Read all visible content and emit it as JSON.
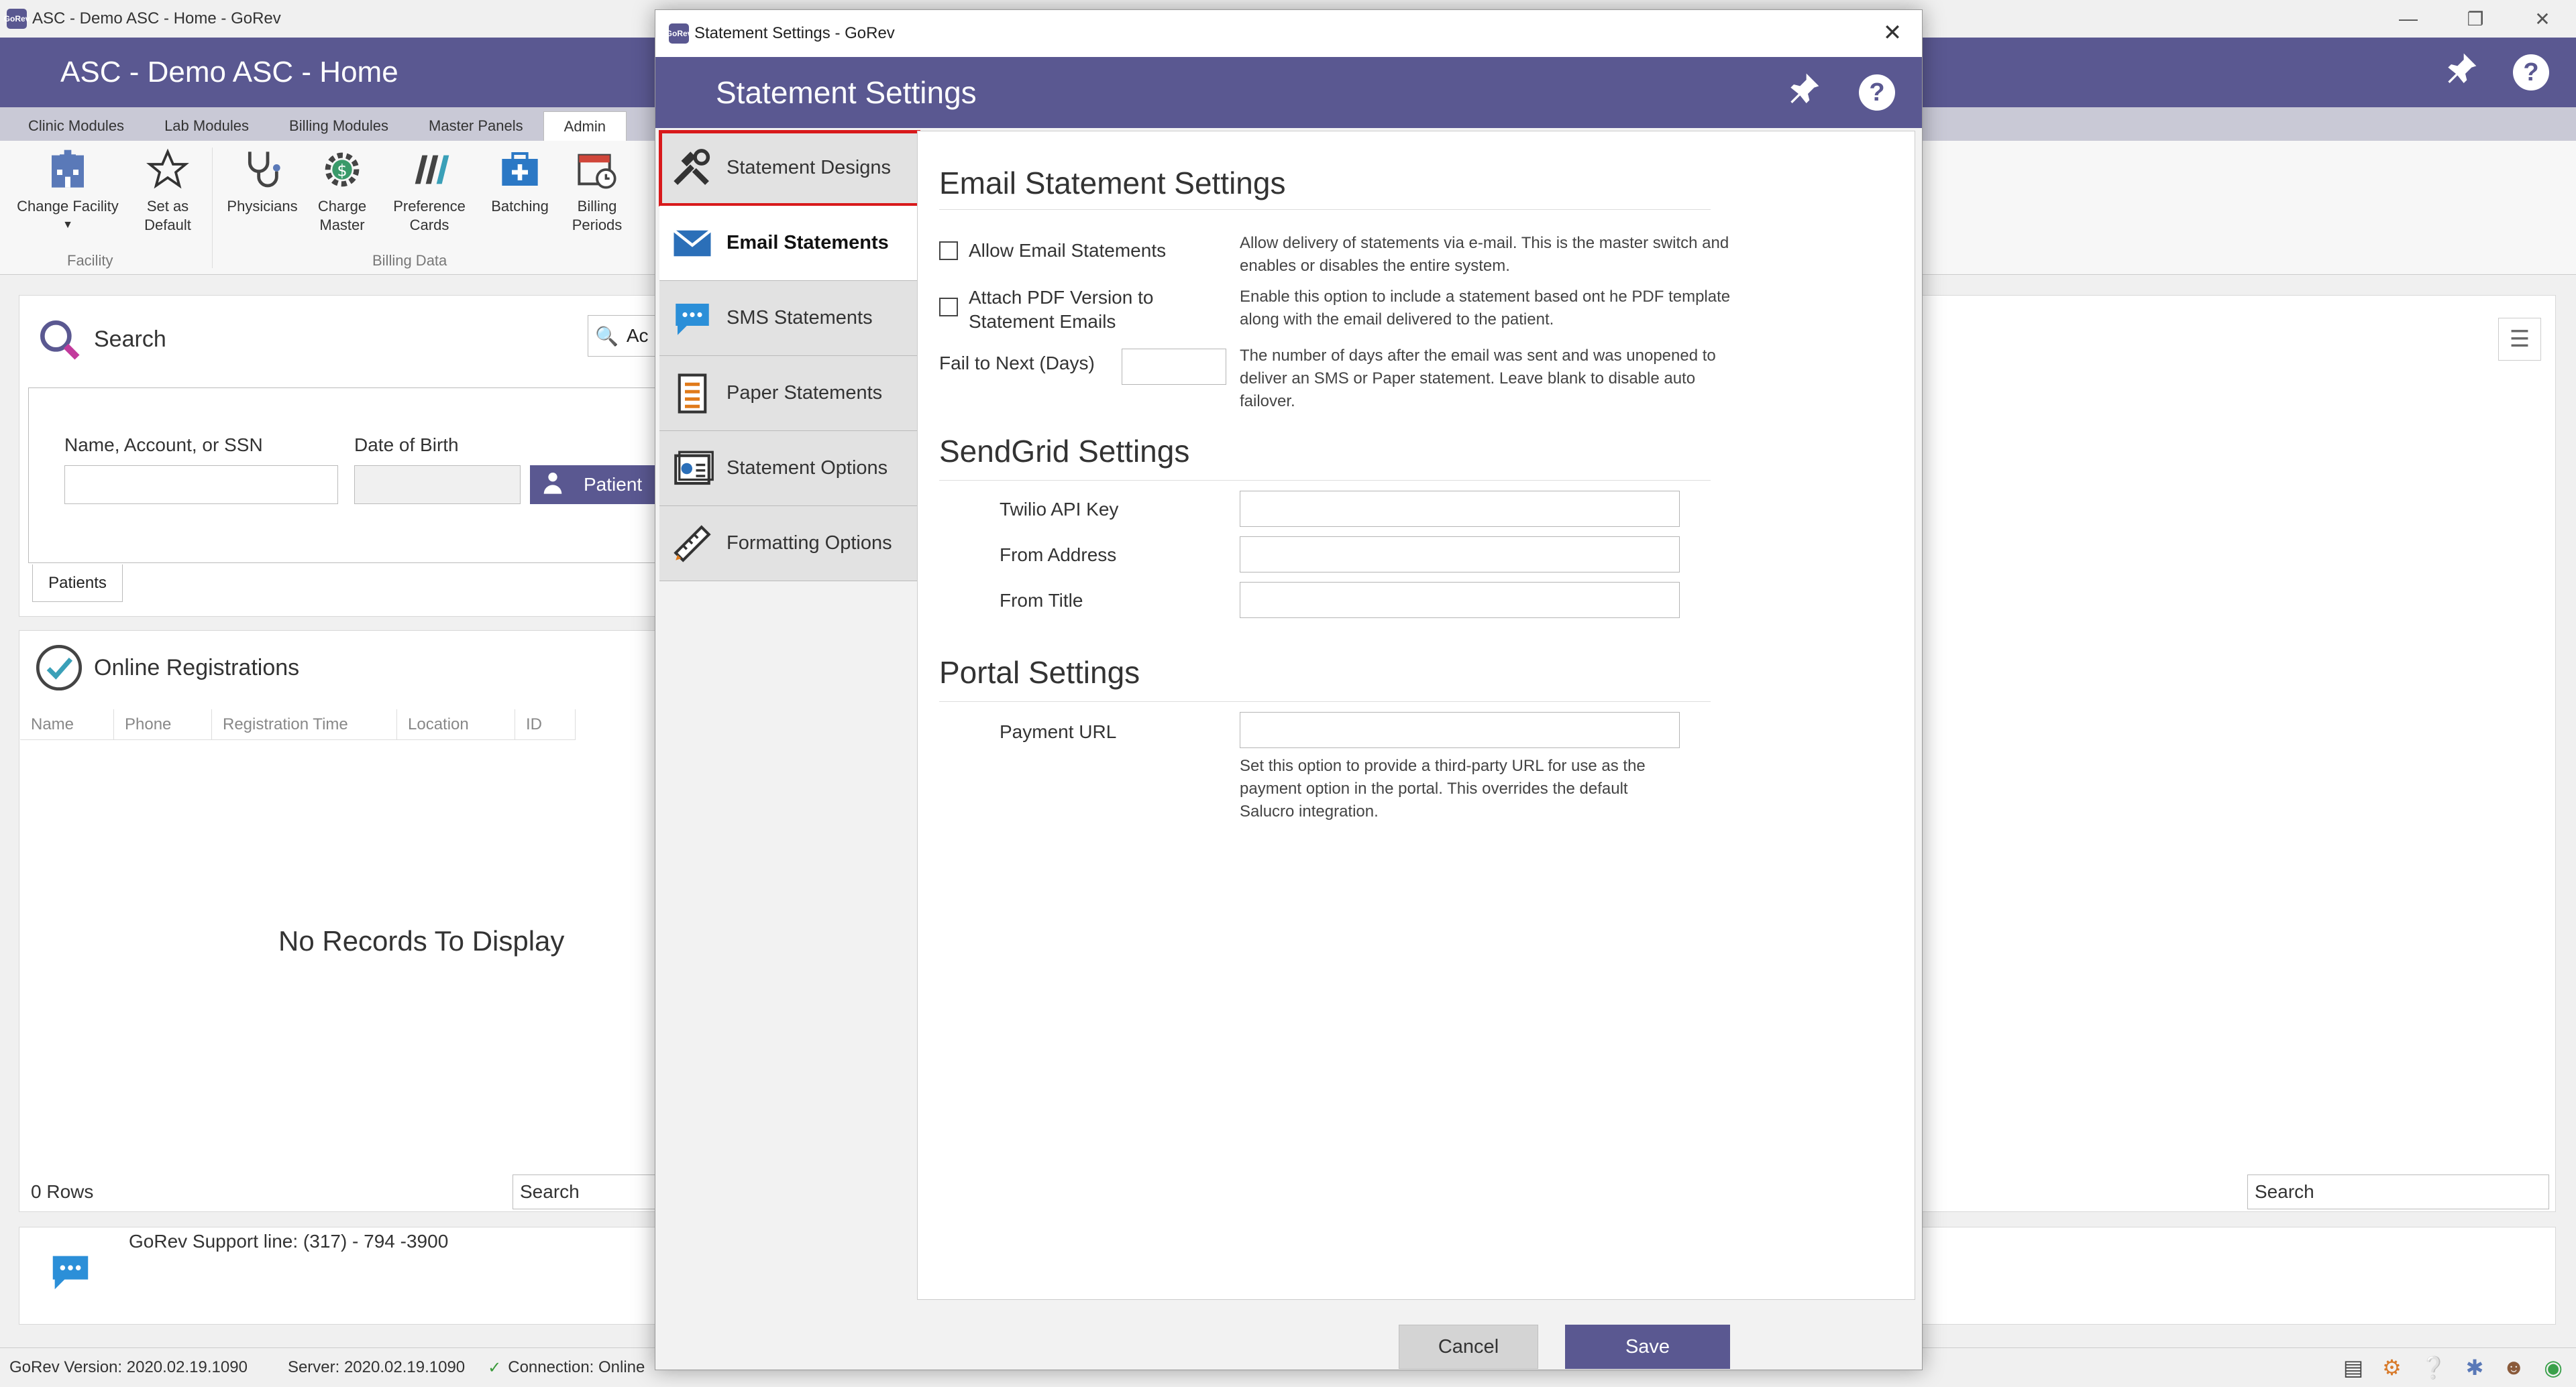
{
  "main_window": {
    "titlebar_text": "ASC - Demo ASC - Home - GoRev",
    "app_logo_text": "GoRev",
    "header_title": "ASC - Demo ASC - Home",
    "ribbon_tabs": [
      "Clinic Modules",
      "Lab Modules",
      "Billing Modules",
      "Master Panels",
      "Admin"
    ],
    "ribbon_buttons": {
      "change_facility": "Change Facility",
      "set_as_default": "Set as Default",
      "physicians": "Physicians",
      "charge_master": "Charge Master",
      "preference_cards": "Preference Cards",
      "batching": "Batching",
      "billing_periods": "Billing Periods"
    },
    "ribbon_groups": {
      "facility": "Facility",
      "billing_data": "Billing Data"
    },
    "search_panel": {
      "title": "Search",
      "name_label": "Name, Account, or SSN",
      "dob_label": "Date of Birth",
      "patient_button": "Patient",
      "patients_tab": "Patients",
      "quick_search_fragment": "Ac"
    },
    "online_registrations": {
      "title": "Online Registrations",
      "columns": [
        "Name",
        "Phone",
        "Registration Time",
        "Location",
        "ID"
      ],
      "empty_text": "No Records To Display",
      "row_count": "0 Rows",
      "search_placeholder": "Search",
      "right_search_placeholder": "Search"
    },
    "support_line": "GoRev Support line: (317) - 794 -3900",
    "status": {
      "version": "GoRev Version: 2020.02.19.1090",
      "server": "Server: 2020.02.19.1090",
      "connection": "Connection: Online"
    }
  },
  "dialog": {
    "window_title": "Statement Settings - GoRev",
    "header_title": "Statement Settings",
    "nav": [
      {
        "label": "Statement Designs",
        "icon": "tools-icon"
      },
      {
        "label": "Email Statements",
        "icon": "envelope-icon"
      },
      {
        "label": "SMS Statements",
        "icon": "chat-bubble-icon"
      },
      {
        "label": "Paper Statements",
        "icon": "paper-icon"
      },
      {
        "label": "Statement Options",
        "icon": "options-icon"
      },
      {
        "label": "Formatting Options",
        "icon": "ruler-icon"
      }
    ],
    "email_section": {
      "title": "Email Statement Settings",
      "allow_label": "Allow Email Statements",
      "allow_help": "Allow delivery of statements via e-mail. This is the master switch and enables or disables the entire system.",
      "attach_label": "Attach PDF Version to Statement Emails",
      "attach_help": "Enable this option to include a statement based ont he PDF template along with the email delivered to the patient.",
      "fail_label": "Fail to Next (Days)",
      "fail_value": "",
      "fail_help": "The number of days after the email was sent and was unopened to deliver an SMS or Paper statement. Leave blank to disable auto failover."
    },
    "sendgrid_section": {
      "title": "SendGrid Settings",
      "api_key_label": "Twilio API Key",
      "from_address_label": "From Address",
      "from_title_label": "From Title"
    },
    "portal_section": {
      "title": "Portal Settings",
      "payment_url_label": "Payment URL",
      "payment_url_help": "Set this option to provide a third-party URL for use as the payment option in the portal. This overrides the default Salucro integration."
    },
    "buttons": {
      "cancel": "Cancel",
      "save": "Save"
    }
  }
}
